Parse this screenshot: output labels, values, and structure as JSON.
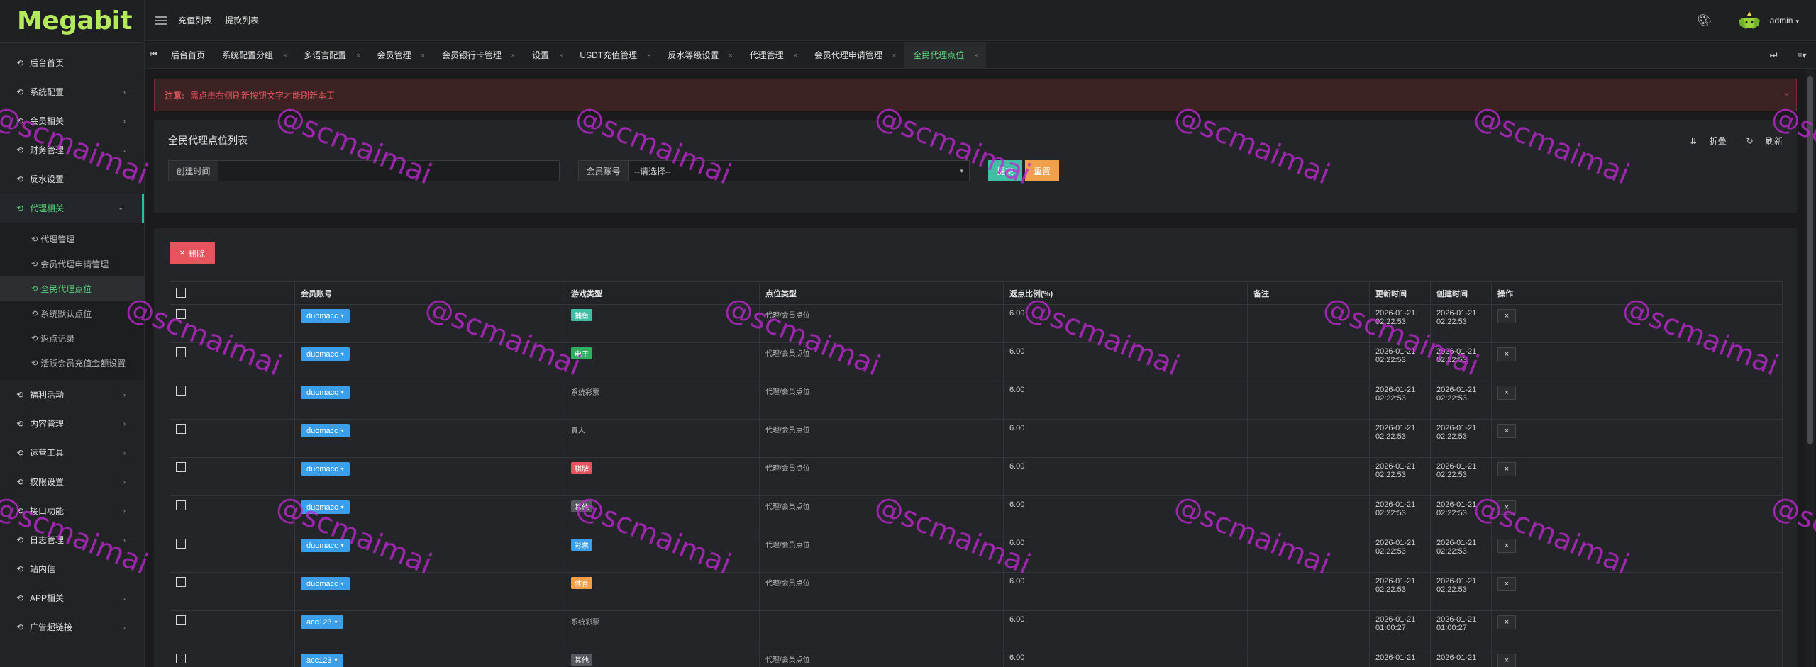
{
  "app": {
    "logo": "Megabit"
  },
  "sidebar": {
    "items": [
      {
        "label": "后台首页",
        "arrow": ""
      },
      {
        "label": "系统配置",
        "arrow": "›"
      },
      {
        "label": "会员相关",
        "arrow": "›"
      },
      {
        "label": "财务管理",
        "arrow": "›"
      },
      {
        "label": "反水设置",
        "arrow": ""
      },
      {
        "label": "代理相关",
        "arrow": "⌄"
      }
    ],
    "sub_items": [
      {
        "label": "代理管理"
      },
      {
        "label": "会员代理申请管理"
      },
      {
        "label": "全民代理点位"
      },
      {
        "label": "系统默认点位"
      },
      {
        "label": "返点记录"
      },
      {
        "label": "活跃会员充值金额设置"
      }
    ],
    "items_after": [
      {
        "label": "福利活动",
        "arrow": "›"
      },
      {
        "label": "内容管理",
        "arrow": "›"
      },
      {
        "label": "运营工具",
        "arrow": "›"
      },
      {
        "label": "权限设置",
        "arrow": "›"
      },
      {
        "label": "接口功能",
        "arrow": "›"
      },
      {
        "label": "日志管理",
        "arrow": "›"
      },
      {
        "label": "站内信",
        "arrow": ""
      },
      {
        "label": "APP相关",
        "arrow": "›"
      },
      {
        "label": "广告超链接",
        "arrow": "›"
      }
    ]
  },
  "header": {
    "links": [
      "充值列表",
      "提款列表"
    ],
    "user": "admin"
  },
  "tabs": [
    {
      "label": "后台首页",
      "close": ""
    },
    {
      "label": "系统配置分组",
      "close": "×"
    },
    {
      "label": "多语言配置",
      "close": "×"
    },
    {
      "label": "会员管理",
      "close": "×"
    },
    {
      "label": "会员银行卡管理",
      "close": "×"
    },
    {
      "label": "设置",
      "close": "×"
    },
    {
      "label": "USDT充值管理",
      "close": "×"
    },
    {
      "label": "反水等级设置",
      "close": "×"
    },
    {
      "label": "代理管理",
      "close": "×"
    },
    {
      "label": "会员代理申请管理",
      "close": "×"
    },
    {
      "label": "全民代理点位",
      "close": "×"
    }
  ],
  "alert": {
    "prefix": "注意:",
    "text": "需点击右侧刷新按钮文字才能刷新本页",
    "close": "×"
  },
  "search": {
    "title": "全民代理点位列表",
    "collapse": "折叠",
    "refresh": "刷新",
    "created_label": "创建时间",
    "created_value": "",
    "account_label": "会员账号",
    "account_value": "--请选择--",
    "submit": "提交",
    "reset": "重置"
  },
  "table": {
    "delete_label": "删除",
    "headers": [
      "会员账号",
      "游戏类型",
      "点位类型",
      "返点比例(%)",
      "备注",
      "更新时间",
      "创建时间",
      "操作"
    ],
    "rows": [
      {
        "account": "duomacc",
        "game": "捕鱼",
        "game_color": "#3fbfa4",
        "point": "代理/会员点位",
        "ratio": "6.00",
        "note": "",
        "updated": "2026-01-21 02:22:53",
        "created": "2026-01-21 02:22:53"
      },
      {
        "account": "duomacc",
        "game": "电子",
        "game_color": "#2fb060",
        "point": "代理/会员点位",
        "ratio": "6.00",
        "note": "",
        "updated": "2026-01-21 02:22:53",
        "created": "2026-01-21 02:22:53"
      },
      {
        "account": "duomacc",
        "game": "系统彩票",
        "game_color": "",
        "point": "代理/会员点位",
        "ratio": "6.00",
        "note": "",
        "updated": "2026-01-21 02:22:53",
        "created": "2026-01-21 02:22:53"
      },
      {
        "account": "duomacc",
        "game": "真人",
        "game_color": "",
        "point": "代理/会员点位",
        "ratio": "6.00",
        "note": "",
        "updated": "2026-01-21 02:22:53",
        "created": "2026-01-21 02:22:53"
      },
      {
        "account": "duomacc",
        "game": "棋牌",
        "game_color": "#e8545e",
        "point": "代理/会员点位",
        "ratio": "6.00",
        "note": "",
        "updated": "2026-01-21 02:22:53",
        "created": "2026-01-21 02:22:53"
      },
      {
        "account": "duomacc",
        "game": "其他",
        "game_color": "#55585e",
        "point": "代理/会员点位",
        "ratio": "6.00",
        "note": "",
        "updated": "2026-01-21 02:22:53",
        "created": "2026-01-21 02:22:53"
      },
      {
        "account": "duomacc",
        "game": "彩票",
        "game_color": "#3b9ee8",
        "point": "代理/会员点位",
        "ratio": "6.00",
        "note": "",
        "updated": "2026-01-21 02:22:53",
        "created": "2026-01-21 02:22:53"
      },
      {
        "account": "duomacc",
        "game": "体育",
        "game_color": "#f0a04b",
        "point": "代理/会员点位",
        "ratio": "6.00",
        "note": "",
        "updated": "2026-01-21 02:22:53",
        "created": "2026-01-21 02:22:53"
      },
      {
        "account": "acc123",
        "game": "系统彩票",
        "game_color": "",
        "point": "",
        "ratio": "6.00",
        "note": "",
        "updated": "2026-01-21 01:00:27",
        "created": "2026-01-21 01:00:27"
      },
      {
        "account": "acc123",
        "game": "其他",
        "game_color": "#55585e",
        "point": "代理/会员点位",
        "ratio": "6.00",
        "note": "",
        "updated": "2026-01-21",
        "created": "2026-01-21"
      }
    ],
    "op_label": "×"
  },
  "watermark": "@scmaimai",
  "colors": {
    "accent": "#5ad37b",
    "logo": "#b6ea5d",
    "danger": "#e8545e",
    "primary": "#3b9ee8",
    "success": "#3fbfa4",
    "warning": "#f0a04b"
  }
}
